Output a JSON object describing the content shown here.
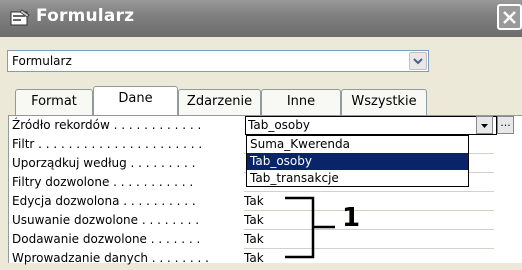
{
  "window": {
    "title": "Formularz",
    "close_icon": "close-icon"
  },
  "object_selector": {
    "value": "Formularz"
  },
  "tabs": [
    {
      "label": "Format",
      "active": false
    },
    {
      "label": "Dane",
      "active": true
    },
    {
      "label": "Zdarzenie",
      "active": false
    },
    {
      "label": "Inne",
      "active": false
    },
    {
      "label": "Wszystkie",
      "active": false
    }
  ],
  "properties": [
    {
      "label": "Źródło rekordów . . . . . . . . . . . .",
      "value": "Tab_osoby"
    },
    {
      "label": "Filtr . . . . . . . . . . . . . . . . . . . . . .",
      "value": ""
    },
    {
      "label": "Uporządkuj według . . . . . . . . .",
      "value": ""
    },
    {
      "label": "Filtry dozwolone . . . . . . . . . . .",
      "value": ""
    },
    {
      "label": "Edycja dozwolona . . . . . . . . . .",
      "value": "Tak"
    },
    {
      "label": "Usuwanie dozwolone . . . . . . . .",
      "value": "Tak"
    },
    {
      "label": "Dodawanie dozwolone . . . . . . .",
      "value": "Tak"
    },
    {
      "label": "Wprowadzanie danych . . . . . . . .",
      "value": "Tak"
    }
  ],
  "record_source_options": [
    "Suma_Kwerenda",
    "Tab_osoby",
    "Tab_transakcje"
  ],
  "selected_option": "Tab_osoby",
  "build_button": "...",
  "callout_number": "1",
  "colors": {
    "selection": "#0a246a",
    "titlebar": "#808080"
  }
}
